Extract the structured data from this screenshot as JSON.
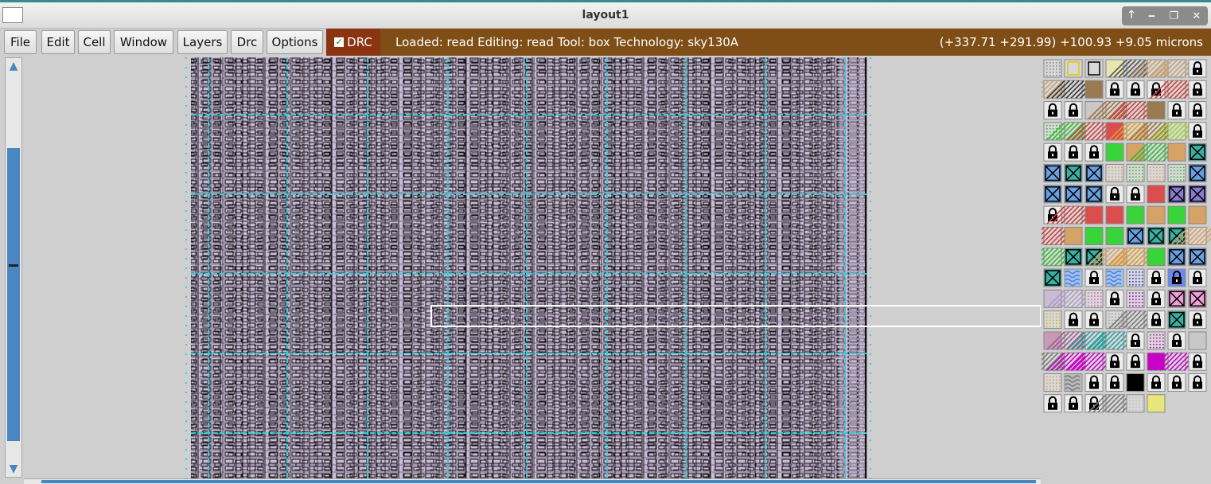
{
  "window": {
    "title": "layout1",
    "controls": [
      "🡑",
      "‒",
      "❐",
      "✕"
    ]
  },
  "menubar": {
    "items": [
      "File",
      "Edit",
      "Cell",
      "Window",
      "Layers",
      "Drc",
      "Options"
    ]
  },
  "drc_toggle": {
    "label": "DRC",
    "checked": true
  },
  "status": {
    "info": "Loaded: read  Editing: read  Tool: box  Technology: sky130A",
    "coordinates": "(+337.71 +291.99) +100.93 +9.05 microns"
  },
  "colors": {
    "status_bg": "#7e4e16",
    "drc_bg": "#8b3412",
    "layout_fill": "#c9bad6",
    "grid_lines": "#2fd0dc",
    "scroll_thumb": "#4a86c0"
  },
  "layer_palette": {
    "rows": [
      [
        "dots-grid",
        "yellow-outline",
        "black-outline",
        "pale-yellow",
        "hatch-gray",
        "hatch-tan",
        "hatch-tan",
        "lock"
      ],
      [
        "hatch-tan",
        "hatch-black",
        "brown",
        "lock",
        "lock",
        "lock",
        "red-hatch",
        "lock"
      ],
      [
        "lock",
        "lock",
        "gray",
        "brown-hatch",
        "red-hatch",
        "brown",
        "lock",
        "lock"
      ],
      [
        "green-dots",
        "green-hatch",
        "red-hatch",
        "red",
        "orange-hatch",
        "brown-hatch",
        "green-yellow-hatch",
        "lock"
      ],
      [
        "lock",
        "lock",
        "lock",
        "green",
        "tan",
        "green-hatch",
        "tan",
        "cross-teal"
      ],
      [
        "cross-blue",
        "cross-teal",
        "cross-blue",
        "tan-dots",
        "green-dots",
        "tan-dots",
        "green-dots",
        "cross-blue"
      ],
      [
        "cross-blue",
        "cross-blue",
        "cross-blue",
        "lock",
        "lock",
        "red",
        "cross-purple",
        "cross-purple"
      ],
      [
        "lock",
        "red-hatch",
        "red",
        "red",
        "green",
        "tan",
        "green",
        "tan"
      ],
      [
        "red-hatch",
        "tan",
        "green",
        "green",
        "cross-blue",
        "cross-teal",
        "cross-teal",
        "tan-hatch"
      ],
      [
        "green-hatch",
        "cross-teal",
        "cross-teal",
        "tan-hatch",
        "orange-hatch",
        "green",
        "cross-blue",
        "cross-blue"
      ],
      [
        "cross-teal",
        "blue-wave",
        "lock",
        "blue-wave",
        "blue-dots",
        "lock",
        "blue-lock",
        "lock"
      ],
      [
        "lavender",
        "lavender-hatch",
        "pink-dots",
        "lock",
        "purple-dots",
        "lock",
        "pink-cross",
        "pink-cross"
      ],
      [
        "yellow-dots",
        "lock",
        "lock",
        "gray-dots",
        "gray-hatch",
        "lock",
        "cross-teal",
        "lock"
      ],
      [
        "mauve",
        "mauve-hatch",
        "teal-hatch",
        "teal-hatch",
        "lock",
        "magenta-dots",
        "lock",
        "gray"
      ],
      [
        "gray-hatch",
        "magenta-hatch",
        "magenta-hatch",
        "lock",
        "lock",
        "magenta",
        "magenta-hatch",
        "lock"
      ],
      [
        "tan-dots",
        "gray-wave",
        "lock",
        "lock",
        "black",
        "lock",
        "lock",
        "lock"
      ],
      [
        "lock",
        "lock",
        "lock",
        "gray-hatch",
        "light-dots",
        "yellow-box"
      ]
    ]
  }
}
